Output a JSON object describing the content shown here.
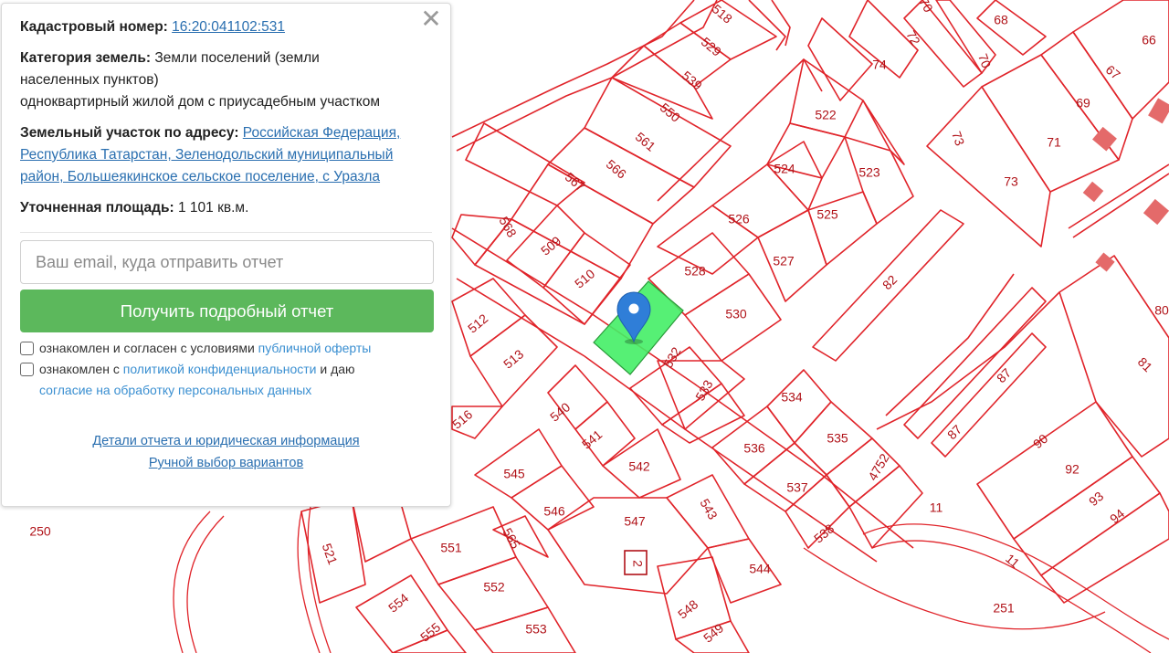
{
  "panel": {
    "cadastral_label": "Кадастровый номер:",
    "cadastral_value": "16:20:041102:531",
    "category_label": "Категория земель:",
    "category_value_1": "Земли поселений (земли",
    "category_value_2": "населенных пунктов)",
    "category_value_3": "одноквартирный жилой дом с приусадебным участком",
    "address_label": "Земельный участок по адресу:",
    "address_value": "Российская Федерация, Республика Татарстан, Зеленодольский муниципальный район, Большеякинское сельское поселение, с Уразла",
    "area_label": "Уточненная площадь:",
    "area_value": "1 101 кв.м.",
    "email_placeholder": "Ваш email, куда отправить отчет",
    "submit_label": "Получить подробный отчет",
    "consent1_text": "ознакомлен и согласен с условиями",
    "consent1_link": "публичной оферты",
    "consent2_text_a": "ознакомлен с",
    "consent2_link_a": "политикой конфиденциальности",
    "consent2_text_b": "и даю",
    "consent2_link_b": "согласие на обработку персональных данных",
    "details_link": "Детали отчета и юридическая информация",
    "manual_link": "Ручной выбор вариантов",
    "close_icon": "close-icon"
  },
  "map": {
    "selected_plot": "531",
    "labels": [
      "518",
      "529",
      "539",
      "550",
      "561",
      "566",
      "567",
      "568",
      "509",
      "510",
      "512",
      "513",
      "516",
      "540",
      "541",
      "542",
      "545",
      "546",
      "547",
      "521",
      "551",
      "552",
      "553",
      "554",
      "555",
      "565",
      "543",
      "544",
      "548",
      "549",
      "528",
      "530",
      "532",
      "533",
      "534",
      "535",
      "536",
      "537",
      "538",
      "4752",
      "522",
      "523",
      "524",
      "525",
      "526",
      "527",
      "82",
      "87",
      "87",
      "90",
      "92",
      "93",
      "94",
      "11",
      "11",
      "251",
      "250",
      "81",
      "80",
      "73",
      "73",
      "71",
      "69",
      "67",
      "66",
      "68",
      "74",
      "72",
      "70",
      "70",
      "2"
    ],
    "colors": {
      "plot_line": "#e0242a",
      "selected_fill": "#44ee66",
      "marker": "#2f7ed8"
    }
  }
}
